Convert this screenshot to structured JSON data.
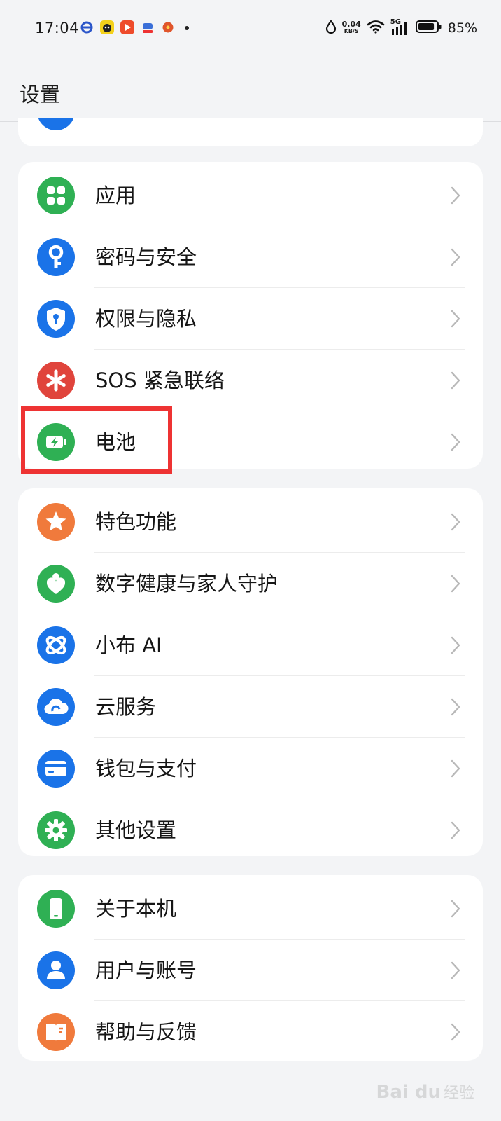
{
  "status_bar": {
    "time": "17:04",
    "notification_icons": [
      {
        "name": "browser-app-icon",
        "color": "#2a55c9"
      },
      {
        "name": "cartoon-app-icon",
        "color": "#f4d11b"
      },
      {
        "name": "video-app-icon",
        "color": "#ee4b2b"
      },
      {
        "name": "news-app-icon",
        "color": "#3a6fd8"
      },
      {
        "name": "shopping-app-icon",
        "color": "#e0552b"
      }
    ],
    "net_speed_value": "0.04",
    "net_speed_unit": "KB/S",
    "network_type": "5G",
    "battery_percent_text": "85%",
    "battery_level": 0.85
  },
  "header": {
    "title": "设置"
  },
  "partial_group": {
    "icon": "partial-blue-icon",
    "color": "#1a73e8"
  },
  "groups": [
    {
      "items": [
        {
          "label": "应用",
          "icon": "apps-grid-icon",
          "color": "#2fb054"
        },
        {
          "label": "密码与安全",
          "icon": "key-icon",
          "color": "#1a73e8"
        },
        {
          "label": "权限与隐私",
          "icon": "shield-lock-icon",
          "color": "#1a73e8"
        },
        {
          "label": "SOS 紧急联络",
          "icon": "asterisk-icon",
          "color": "#e0443c"
        },
        {
          "label": "电池",
          "icon": "battery-icon",
          "color": "#2fb054",
          "highlighted": true
        }
      ]
    },
    {
      "items": [
        {
          "label": "特色功能",
          "icon": "star-icon",
          "color": "#f07a3c"
        },
        {
          "label": "数字健康与家人守护",
          "icon": "heart-person-icon",
          "color": "#2fb054"
        },
        {
          "label": "小布 AI",
          "icon": "orbit-icon",
          "color": "#1a73e8"
        },
        {
          "label": "云服务",
          "icon": "cloud-icon",
          "color": "#1a73e8"
        },
        {
          "label": "钱包与支付",
          "icon": "card-icon",
          "color": "#1a73e8"
        },
        {
          "label": "其他设置",
          "icon": "gear-icon",
          "color": "#2fb054"
        }
      ]
    },
    {
      "items": [
        {
          "label": "关于本机",
          "icon": "phone-icon",
          "color": "#2fb054"
        },
        {
          "label": "用户与账号",
          "icon": "user-icon",
          "color": "#1a73e8"
        },
        {
          "label": "帮助与反馈",
          "icon": "book-icon",
          "color": "#f07a3c"
        }
      ]
    }
  ],
  "watermark": {
    "brand": "Bai du",
    "suffix": "经验"
  }
}
